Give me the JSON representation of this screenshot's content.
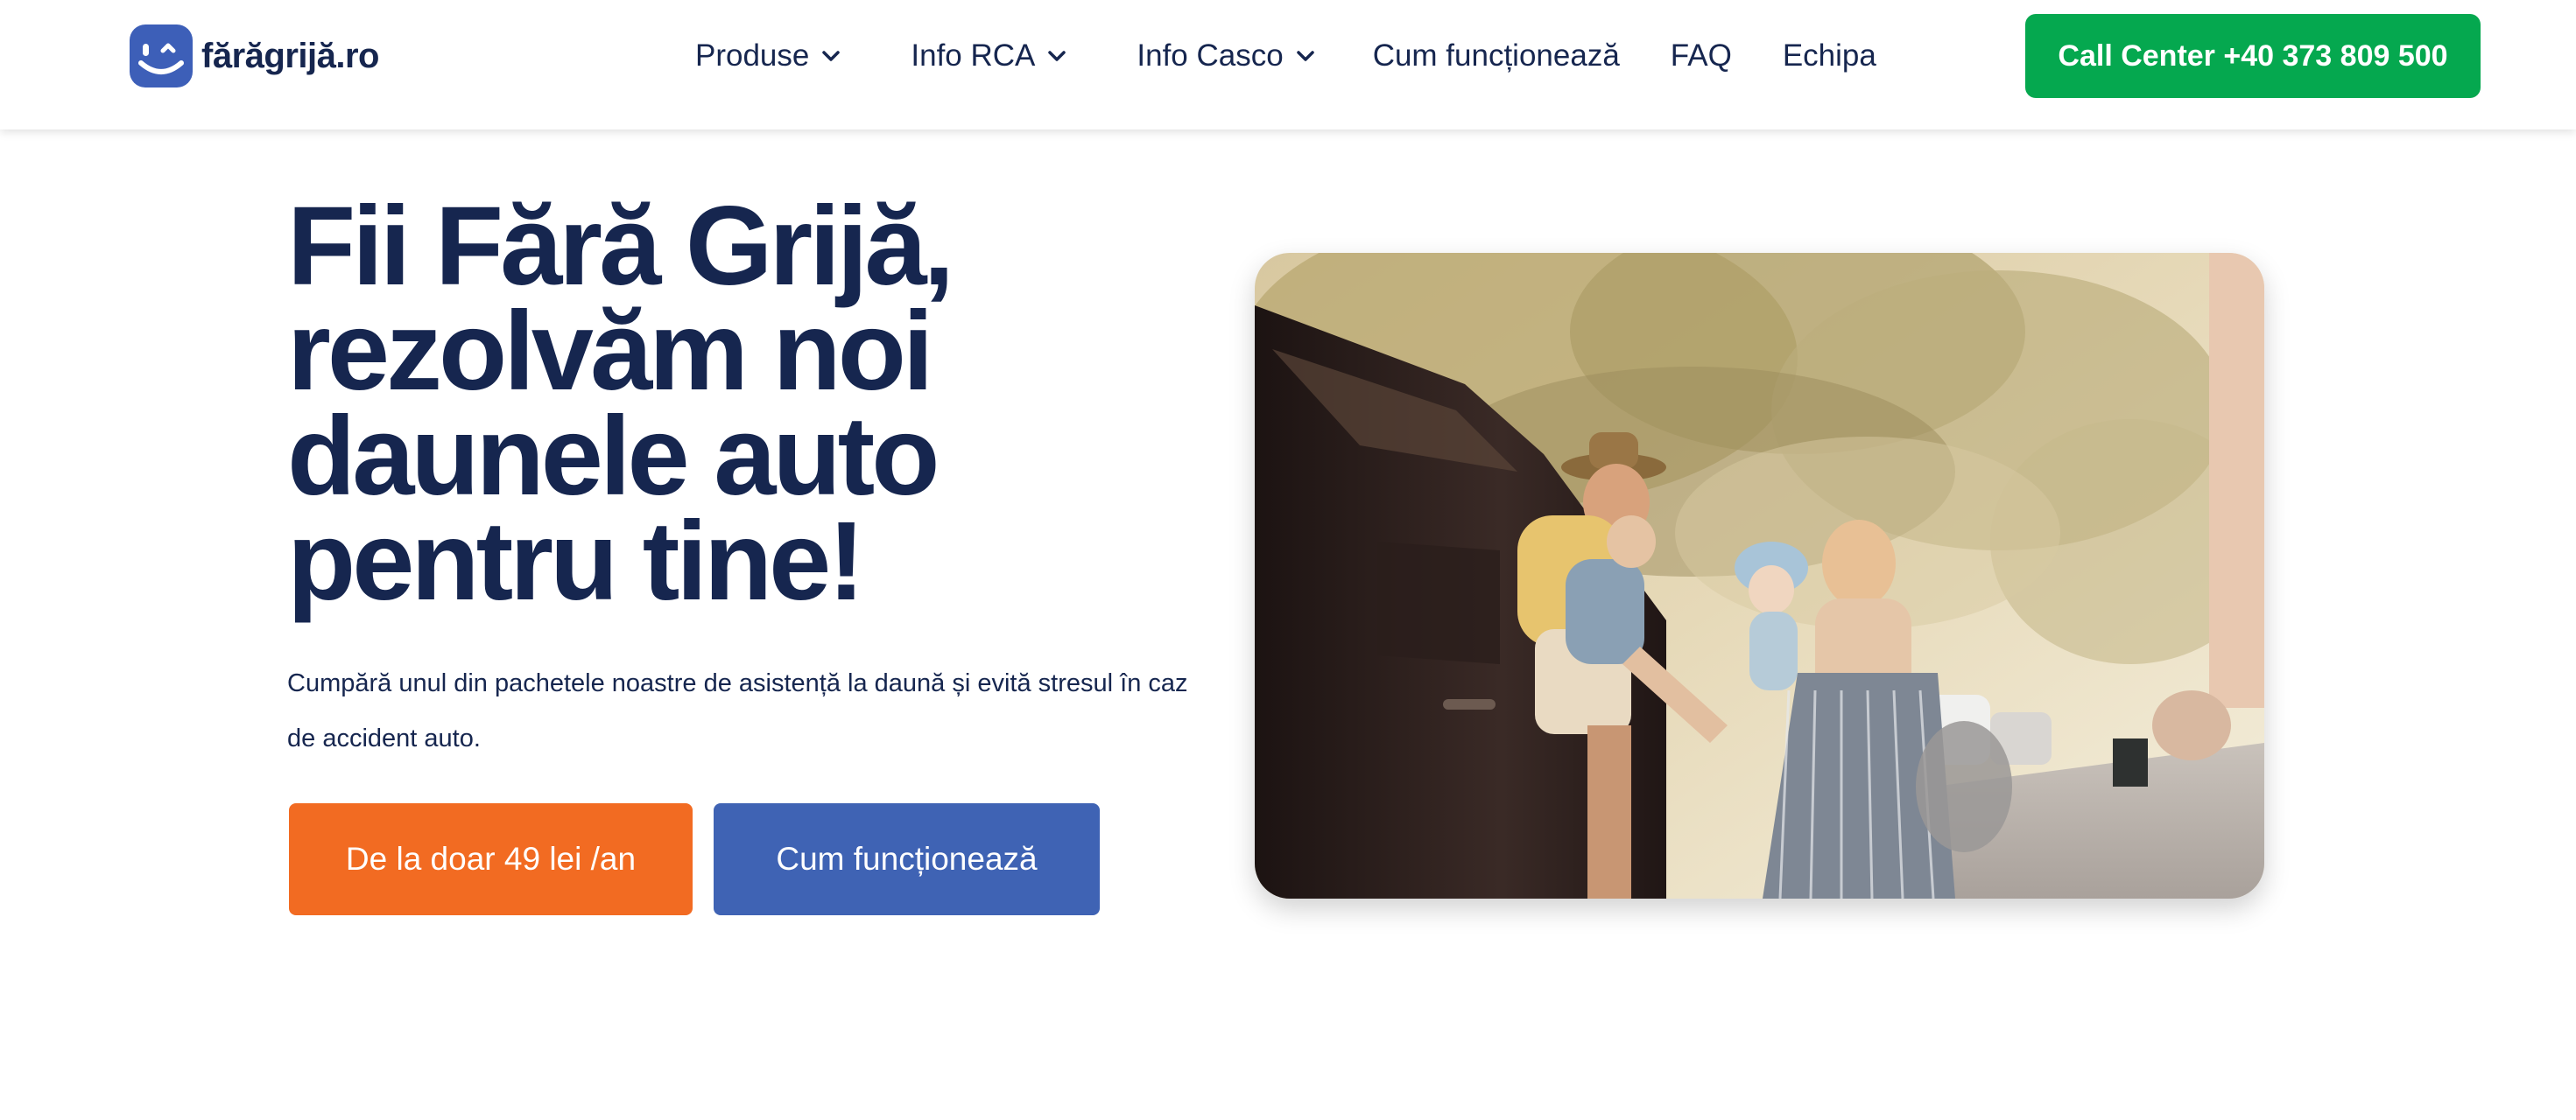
{
  "header": {
    "logo_text": "fărăgrijă.ro",
    "logo_icon": "winking-smiley-icon",
    "nav": [
      {
        "label": "Produse",
        "has_dropdown": true
      },
      {
        "label": "Info RCA",
        "has_dropdown": true
      },
      {
        "label": "Info Casco",
        "has_dropdown": true
      },
      {
        "label": "Cum funcționează",
        "has_dropdown": false
      },
      {
        "label": "FAQ",
        "has_dropdown": false
      },
      {
        "label": "Echipa",
        "has_dropdown": false
      }
    ],
    "call_center_label": "Call Center +40 373 809 500"
  },
  "hero": {
    "title_lines": [
      "Fii Fără Grijă,",
      "rezolvăm noi",
      "daunele auto",
      "pentru tine!"
    ],
    "subtitle_lines": [
      "Cumpără unul din pachetele noastre de asistență la daună și evită stresul în caz",
      "de accident auto."
    ],
    "primary_button": "De la doar 49 lei /an",
    "secondary_button": "Cum funcționează"
  },
  "colors": {
    "brand_navy": "#16264f",
    "brand_blue": "#3f63b4",
    "call_green": "#05a84f",
    "cta_orange": "#f26b22"
  }
}
